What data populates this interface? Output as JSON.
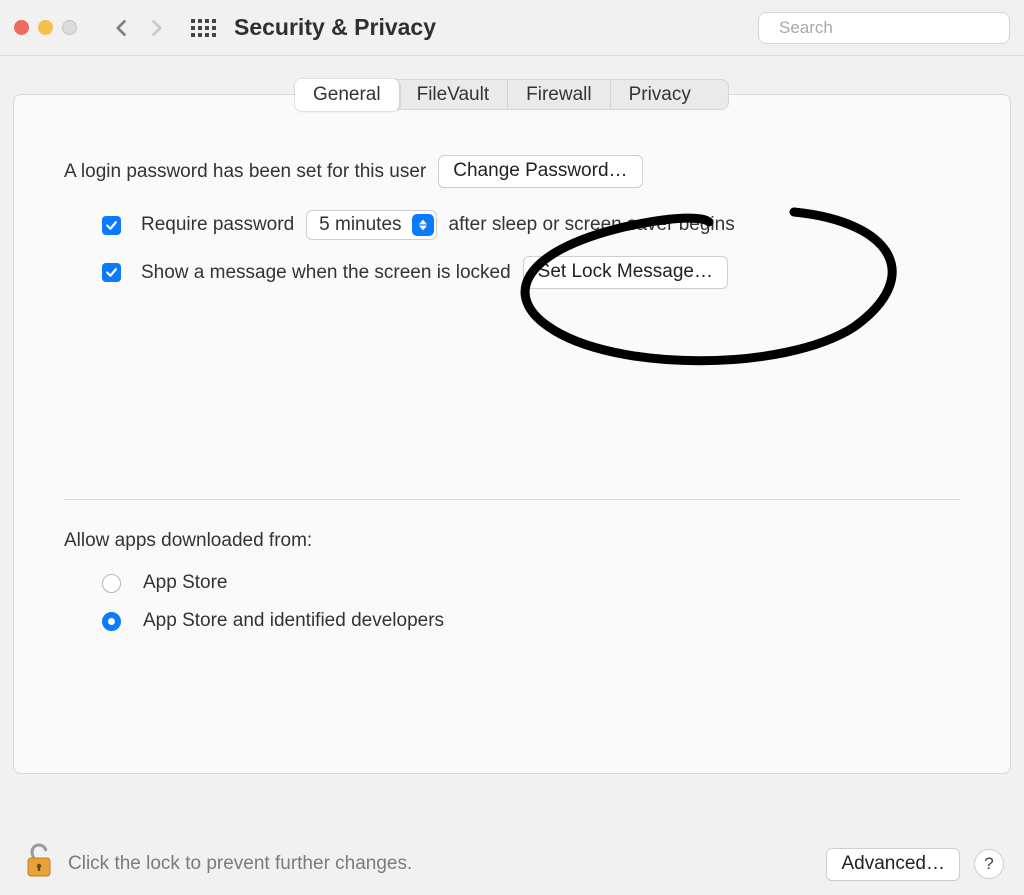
{
  "window": {
    "title": "Security & Privacy",
    "search_placeholder": "Search"
  },
  "tabs": {
    "general": "General",
    "filevault": "FileVault",
    "firewall": "Firewall",
    "privacy": "Privacy",
    "active": "general"
  },
  "general": {
    "login_pw_prefix": "A login password has been set for this user",
    "change_pw_btn": "Change Password…",
    "require_pw_label_left": "Require password",
    "require_pw_select": "5 minutes",
    "require_pw_label_right": "after sleep or screen saver begins",
    "require_pw_checked": true,
    "show_msg_label": "Show a message when the screen is locked",
    "show_msg_checked": true,
    "set_lock_btn": "Set Lock Message…",
    "allow_apps_heading": "Allow apps downloaded from:",
    "radio_app_store": "App Store",
    "radio_identified": "App Store and identified developers",
    "radio_selected": "identified"
  },
  "footer": {
    "lock_hint": "Click the lock to prevent further changes.",
    "advanced_btn": "Advanced…",
    "help": "?"
  }
}
